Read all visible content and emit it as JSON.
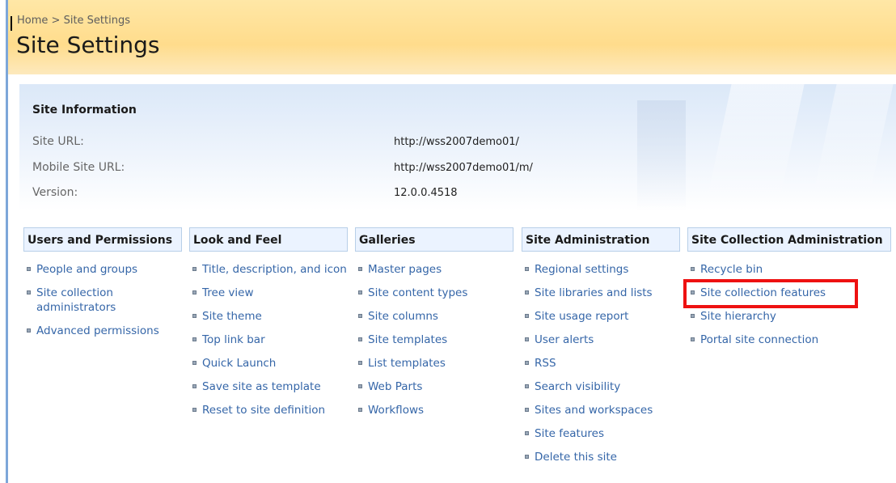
{
  "breadcrumb": {
    "home": "Home",
    "separator": ">",
    "current": "Site Settings"
  },
  "page_title": "Site Settings",
  "site_information": {
    "heading": "Site Information",
    "rows": [
      {
        "label": "Site URL:",
        "value": "http://wss2007demo01/"
      },
      {
        "label": "Mobile Site URL:",
        "value": "http://wss2007demo01/m/"
      },
      {
        "label": "Version:",
        "value": "12.0.0.4518"
      }
    ]
  },
  "sections": [
    {
      "title": "Users and Permissions",
      "links": [
        "People and groups",
        "Site collection administrators",
        "Advanced permissions"
      ]
    },
    {
      "title": "Look and Feel",
      "links": [
        "Title, description, and icon",
        "Tree view",
        "Site theme",
        "Top link bar",
        "Quick Launch",
        "Save site as template",
        "Reset to site definition"
      ]
    },
    {
      "title": "Galleries",
      "links": [
        "Master pages",
        "Site content types",
        "Site columns",
        "Site templates",
        "List templates",
        "Web Parts",
        "Workflows"
      ]
    },
    {
      "title": "Site Administration",
      "links": [
        "Regional settings",
        "Site libraries and lists",
        "Site usage report",
        "User alerts",
        "RSS",
        "Search visibility",
        "Sites and workspaces",
        "Site features",
        "Delete this site"
      ]
    },
    {
      "title": "Site Collection Administration",
      "links": [
        "Recycle bin",
        "Site collection features",
        "Site hierarchy",
        "Portal site connection"
      ]
    }
  ],
  "highlight": {
    "section": "Site Collection Administration",
    "link": "Site collection features",
    "color": "#ee1111"
  },
  "colors": {
    "link": "#3566a8",
    "header_bg": "#ffdc8c",
    "section_header_bg": "#ebf3ff"
  }
}
